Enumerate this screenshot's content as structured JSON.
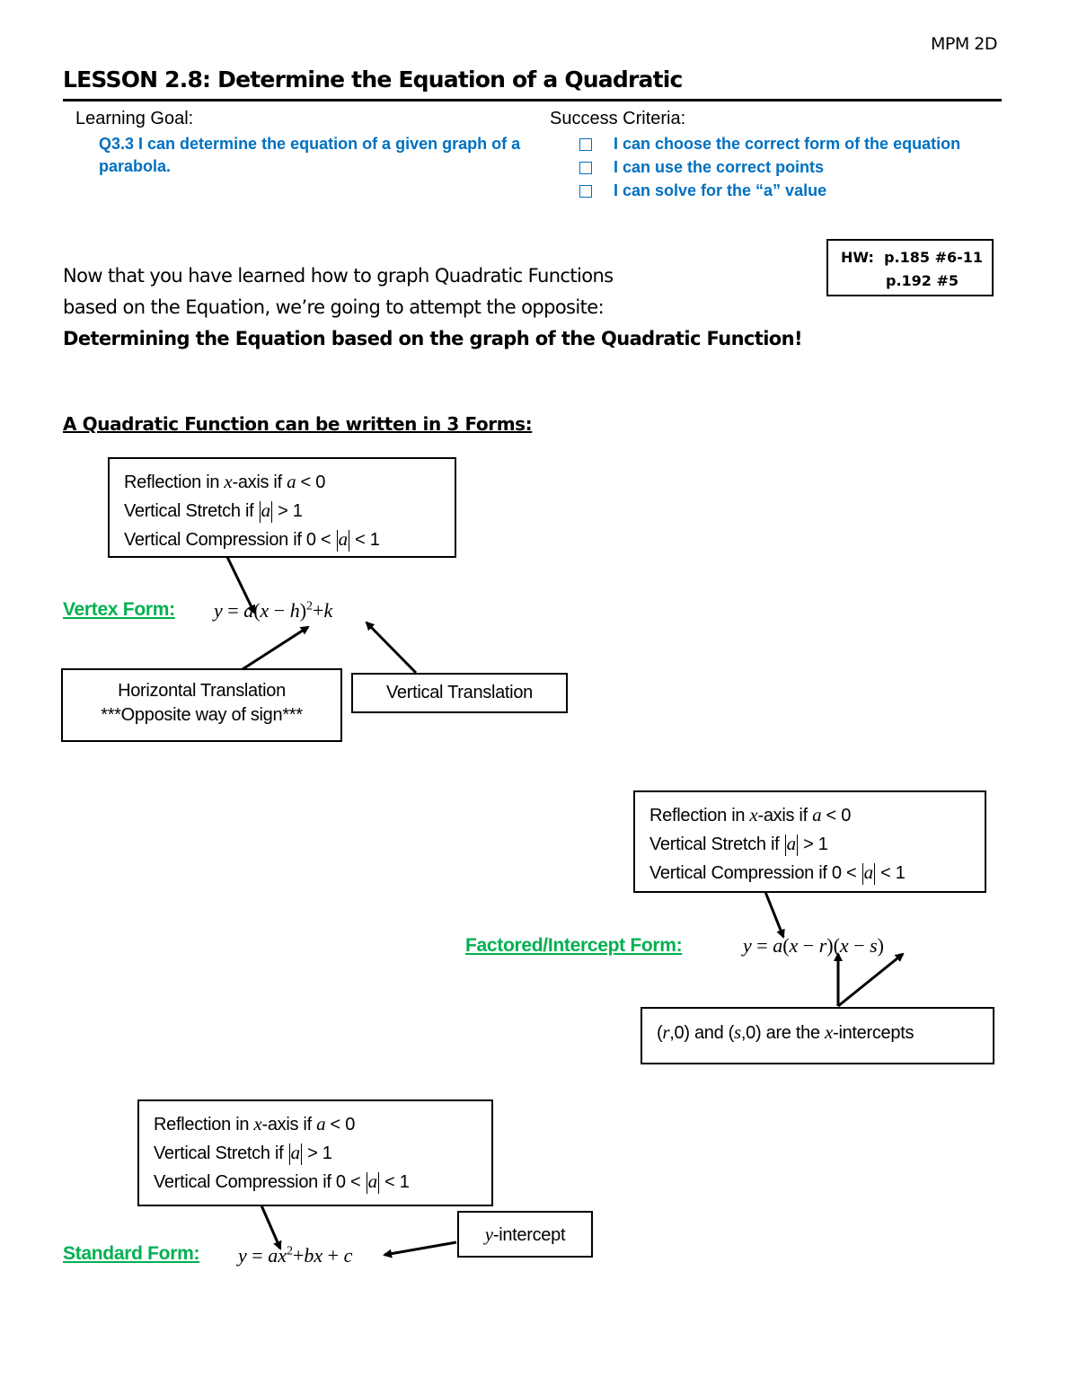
{
  "header": {
    "course_code": "MPM 2D",
    "title": "LESSON 2.8:  Determine the Equation of a Quadratic"
  },
  "learning_goal": {
    "label": "Learning Goal:",
    "text": "Q3.3 I can determine the equation of a given graph of a parabola."
  },
  "success_criteria": {
    "label": "Success Criteria:",
    "items": [
      {
        "text": "I can choose the correct form of the equation",
        "checked": false
      },
      {
        "text": "I can use the correct points",
        "checked": false
      },
      {
        "text": "I can solve for the “a” value",
        "checked": false
      }
    ]
  },
  "homework": {
    "line1": "HW:  p.185 #6-11",
    "line2": "p.192 #5"
  },
  "intro": {
    "line1": "Now that you have learned how to graph Quadratic Functions",
    "line2": "based on the Equation, we’re going to attempt the opposite:",
    "emphasis": "Determining the Equation based on the graph of the Quadratic Function!"
  },
  "section_heading": "A Quadratic Function can be written in 3 Forms:",
  "a_box": {
    "reflection_prefix": "Reflection in ",
    "x_var": "x",
    "reflection_mid": "-axis if ",
    "a_var": "a",
    "reflection_suffix": " < 0",
    "stretch_prefix": "Vertical Stretch if ",
    "stretch_suffix": " > 1",
    "compression_prefix": "Vertical Compression if 0 < ",
    "compression_suffix": " < 1"
  },
  "forms": {
    "vertex": {
      "label": "Vertex Form:",
      "equation": {
        "y": "y",
        "eq": " = ",
        "a": "a",
        "open": "(",
        "x": "x",
        "minus": " − ",
        "h": "h",
        "close": ")",
        "exp": "2",
        "plus": "+",
        "k": "k"
      },
      "annotations": {
        "horizontal_line1": "Horizontal Translation",
        "horizontal_line2": "***Opposite way of sign***",
        "vertical": "Vertical Translation"
      }
    },
    "factored": {
      "label": "Factored/Intercept Form:",
      "equation": {
        "y": "y",
        "eq": " = ",
        "a": "a",
        "open1": "(",
        "x1": "x",
        "minus1": " − ",
        "r": "r",
        "mid": ")(",
        "x2": "x",
        "minus2": " − ",
        "s": "s",
        "close": ")"
      },
      "annotations": {
        "intercepts_r": "r",
        "intercepts_part1": ",0) and (",
        "intercepts_s": "s",
        "intercepts_part2": ",0) are the ",
        "intercepts_x": "x",
        "intercepts_part3": "-intercepts",
        "open": "("
      }
    },
    "standard": {
      "label": "Standard Form:",
      "equation": {
        "y": "y",
        "eq": " = ",
        "a": "a",
        "x": "x",
        "exp": "2",
        "plus1": "+",
        "b": "b",
        "x2": "x",
        "plus2": " + ",
        "c": "c"
      },
      "annotations": {
        "y_var": "y",
        "y_intercept_suffix": "-intercept"
      }
    }
  },
  "colors": {
    "goal_blue": "#0070c0",
    "form_green": "#00b050"
  }
}
